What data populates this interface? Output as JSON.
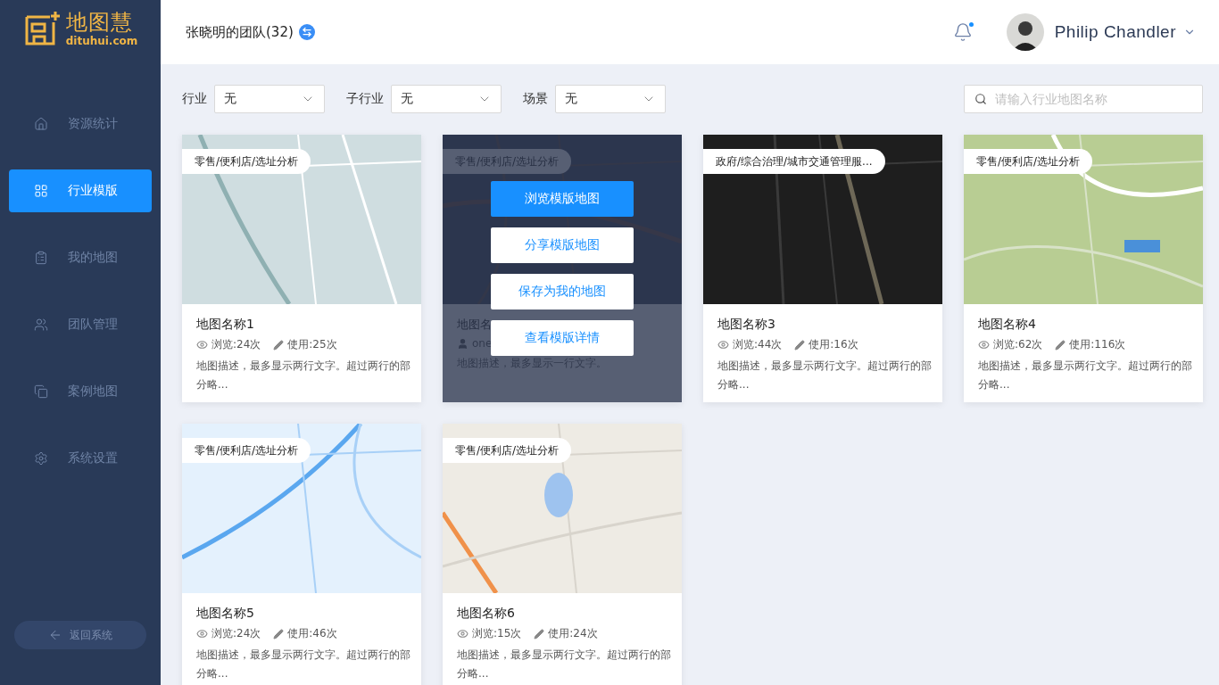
{
  "logo": {
    "name": "地图慧",
    "domain": "dituhui.com"
  },
  "sidebar": {
    "items": [
      {
        "label": "资源统计",
        "selected": false
      },
      {
        "label": "行业模版",
        "selected": true
      },
      {
        "label": "我的地图",
        "selected": false
      },
      {
        "label": "团队管理",
        "selected": false
      },
      {
        "label": "案例地图",
        "selected": false
      },
      {
        "label": "系统设置",
        "selected": false
      }
    ],
    "back_button": "返回系统"
  },
  "header": {
    "team": "张晓明的团队(32)",
    "has_notification": true,
    "user_name": "Philip Chandler"
  },
  "filters": [
    {
      "label": "行业",
      "value": "无"
    },
    {
      "label": "子行业",
      "value": "无"
    },
    {
      "label": "场景",
      "value": "无"
    }
  ],
  "search": {
    "placeholder": "请输入行业地图名称"
  },
  "cards": [
    {
      "tag": "零售/便利店/选址分析",
      "title": "地图名称1",
      "meta": {
        "kind": "stats",
        "views": "浏览:24次",
        "uses": "使用:25次"
      },
      "description": "地图描述，最多显示两行文字。超过两行的部分略...",
      "hovered": false
    },
    {
      "tag": "零售/便利店/选址分析",
      "title": "地图名",
      "meta": {
        "kind": "author",
        "author": "one"
      },
      "description": "地图描述，最多显示一行文字。",
      "hovered": true,
      "actions": [
        {
          "label": "浏览模版地图",
          "primary": true
        },
        {
          "label": "分享模版地图",
          "primary": false
        },
        {
          "label": "保存为我的地图",
          "primary": false
        },
        {
          "label": "查看模版详情",
          "primary": false
        }
      ]
    },
    {
      "tag": "政府/综合治理/城市交通管理服...",
      "title": "地图名称3",
      "meta": {
        "kind": "stats",
        "views": "浏览:44次",
        "uses": "使用:16次"
      },
      "description": "地图描述，最多显示两行文字。超过两行的部分略...",
      "hovered": false
    },
    {
      "tag": "零售/便利店/选址分析",
      "title": "地图名称4",
      "meta": {
        "kind": "stats",
        "views": "浏览:62次",
        "uses": "使用:116次"
      },
      "description": "地图描述，最多显示两行文字。超过两行的部分略...",
      "hovered": false
    },
    {
      "tag": "零售/便利店/选址分析",
      "title": "地图名称5",
      "meta": {
        "kind": "stats",
        "views": "浏览:24次",
        "uses": "使用:46次"
      },
      "description": "地图描述，最多显示两行文字。超过两行的部分略...",
      "hovered": false
    },
    {
      "tag": "零售/便利店/选址分析",
      "title": "地图名称6",
      "meta": {
        "kind": "stats",
        "views": "浏览:15次",
        "uses": "使用:24次"
      },
      "description": "地图描述，最多显示两行文字。超过两行的部分略...",
      "hovered": false
    }
  ]
}
